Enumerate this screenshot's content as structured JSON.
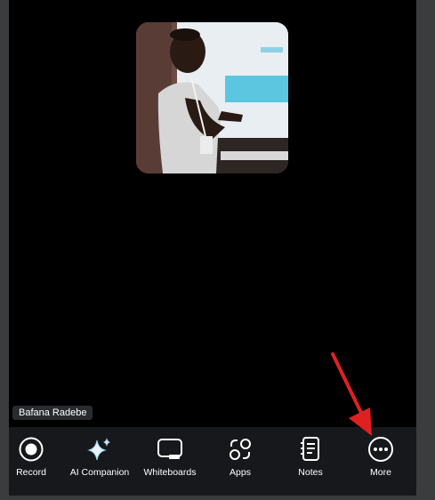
{
  "participant": {
    "name": "Bafana Radebe"
  },
  "toolbar": {
    "items": [
      {
        "label": "Record",
        "icon": "record-icon"
      },
      {
        "label": "AI Companion",
        "icon": "sparkle-icon"
      },
      {
        "label": "Whiteboards",
        "icon": "whiteboard-icon"
      },
      {
        "label": "Apps",
        "icon": "apps-icon"
      },
      {
        "label": "Notes",
        "icon": "notes-icon"
      },
      {
        "label": "More",
        "icon": "more-icon"
      }
    ]
  },
  "colors": {
    "video_bg": "#000000",
    "toolbar_bg": "#17181b",
    "annotation_arrow": "#e02020",
    "ai_sparkle": "#7fc8f0"
  }
}
